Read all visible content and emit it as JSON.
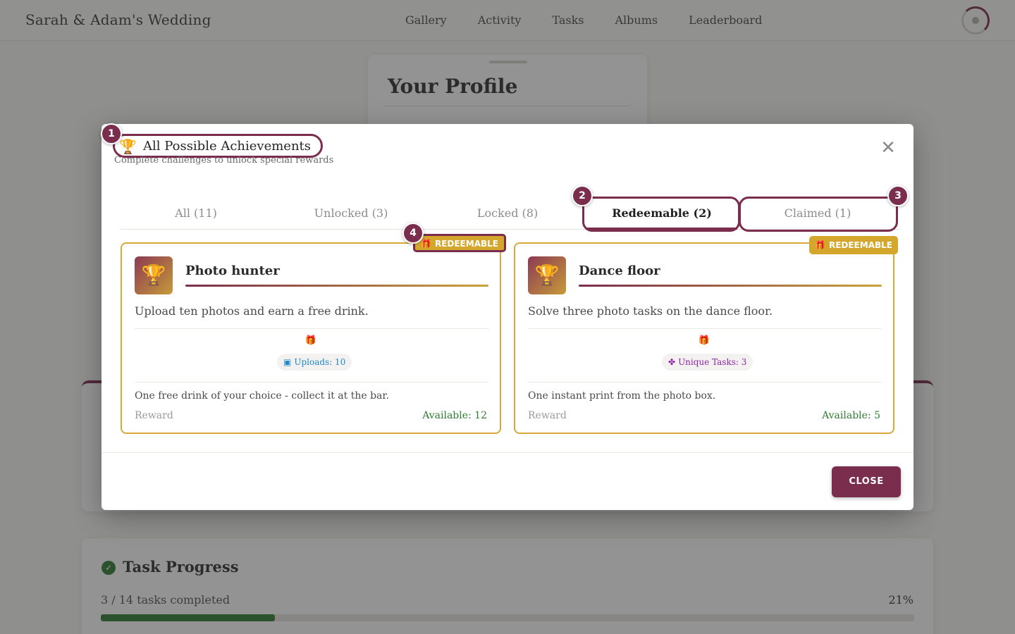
{
  "header": {
    "brand": "Sarah & Adam's Wedding",
    "nav": [
      "Gallery",
      "Activity",
      "Tasks",
      "Albums",
      "Leaderboard"
    ]
  },
  "profile": {
    "title": "Your Profile"
  },
  "task_progress": {
    "title": "Task Progress",
    "summary": "3 / 14 tasks completed",
    "percent_label": "21%",
    "fraction": 0.214,
    "check_icon": "check-circle-icon"
  },
  "modal": {
    "title": "All Possible Achievements",
    "title_icon": "trophy-icon",
    "subtitle": "Complete challenges to unlock special rewards",
    "tabs": [
      {
        "label": "All (11)"
      },
      {
        "label": "Unlocked (3)"
      },
      {
        "label": "Locked (8)"
      },
      {
        "label": "Redeemable (2)"
      },
      {
        "label": "Claimed (1)"
      }
    ],
    "active_tab": "Redeemable (2)",
    "callouts": [
      "1",
      "2",
      "3",
      "4"
    ],
    "achievements": [
      {
        "name": "Photo hunter",
        "icon": "trophy-icon",
        "badge": "REDEEMABLE",
        "description": "Upload ten photos and earn a free drink.",
        "requirement": "Uploads: 10",
        "requirement_icon": "image-icon",
        "requirement_color": "#1e88c8",
        "reward": "One free drink of your choice - collect it at the bar.",
        "reward_label": "Reward",
        "available": "Available: 12"
      },
      {
        "name": "Dance floor",
        "icon": "trophy-icon",
        "badge": "REDEEMABLE",
        "description": "Solve three photo tasks on the dance floor.",
        "requirement": "Unique Tasks: 3",
        "requirement_icon": "puzzle-icon",
        "requirement_color": "#8e24aa",
        "reward": "One instant print from the photo box.",
        "reward_label": "Reward",
        "available": "Available: 5"
      }
    ],
    "close_button": "CLOSE"
  },
  "colors": {
    "accent": "#7b2d4e",
    "gold": "#d4a72c",
    "success": "#2e7d32"
  }
}
